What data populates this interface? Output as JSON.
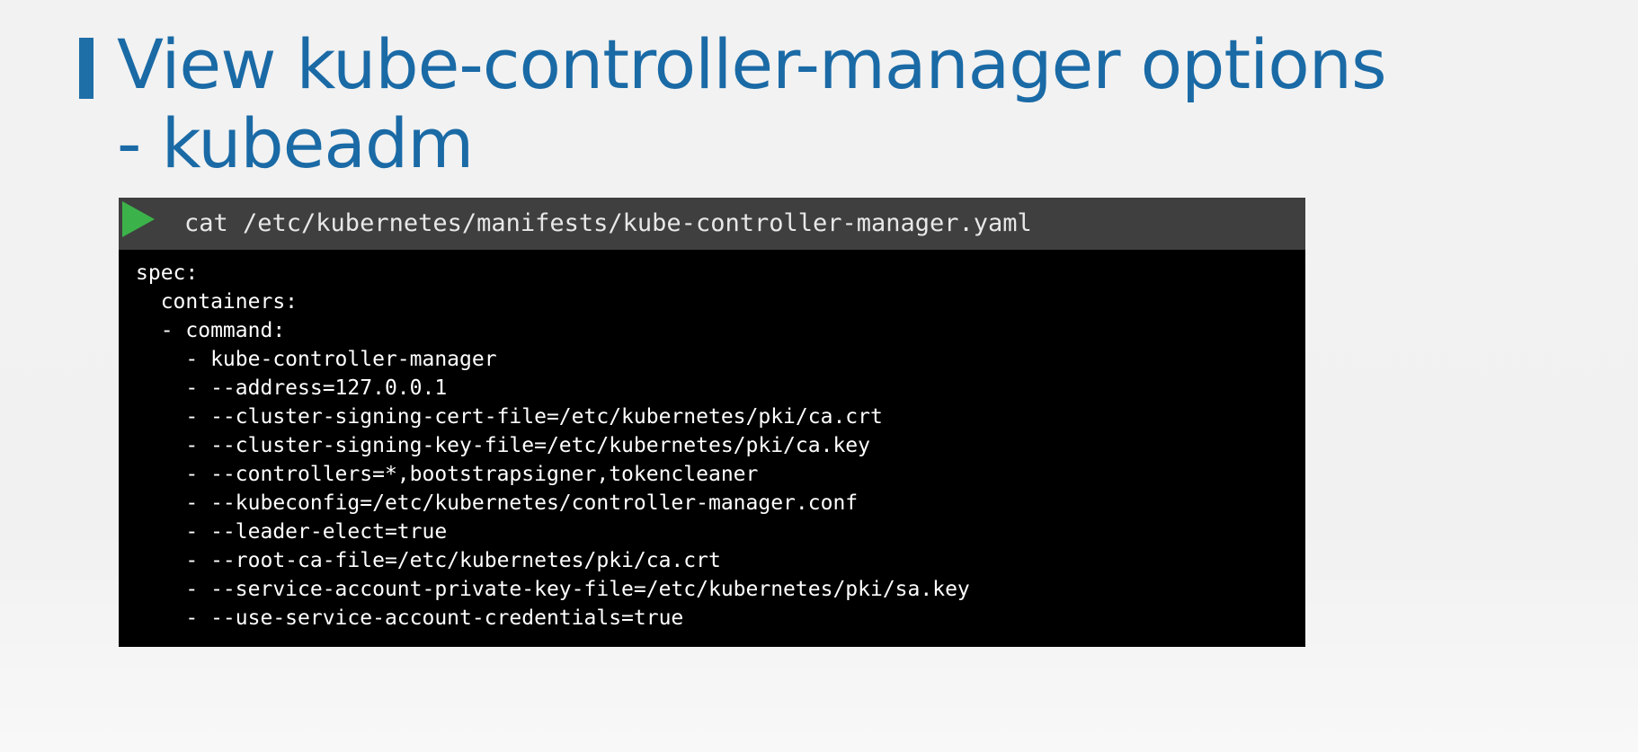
{
  "slide": {
    "title_lines": [
      "View kube-controller-manager options",
      "- kubeadm"
    ]
  },
  "terminal": {
    "prompt_icon": "play-triangle-icon",
    "prompt_icon_color": "#3cb34a",
    "command": "cat /etc/kubernetes/manifests/kube-controller-manager.yaml",
    "output_lines": [
      "spec:",
      "  containers:",
      "  - command:",
      "    - kube-controller-manager",
      "    - --address=127.0.0.1",
      "    - --cluster-signing-cert-file=/etc/kubernetes/pki/ca.crt",
      "    - --cluster-signing-key-file=/etc/kubernetes/pki/ca.key",
      "    - --controllers=*,bootstrapsigner,tokencleaner",
      "    - --kubeconfig=/etc/kubernetes/controller-manager.conf",
      "    - --leader-elect=true",
      "    - --root-ca-file=/etc/kubernetes/pki/ca.crt",
      "    - --service-account-private-key-file=/etc/kubernetes/pki/sa.key",
      "    - --use-service-account-credentials=true"
    ]
  }
}
